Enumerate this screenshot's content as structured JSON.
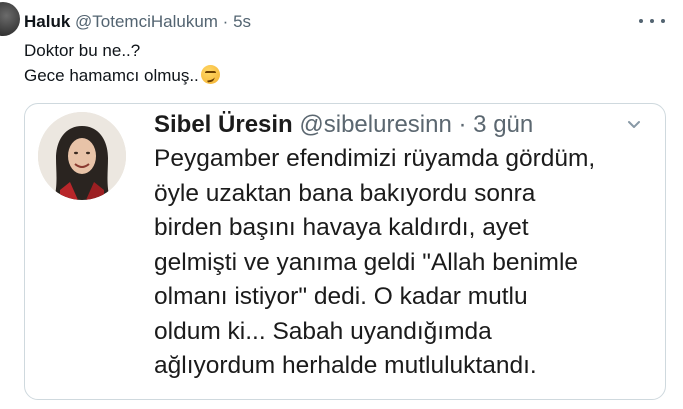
{
  "tweet": {
    "author_name": "Haluk",
    "author_handle": "@TotemciHalukum",
    "separator": "·",
    "time": "5s",
    "lines": [
      "Doktor bu ne..?",
      "Gece hamamcı olmuş.."
    ],
    "emoji": "smirking-face"
  },
  "quote": {
    "author_name": "Sibel Üresin",
    "author_handle": "@sibeluresinn",
    "separator": "·",
    "time": "3 gün",
    "lines": [
      "Peygamber efendimizi rüyamda gördüm,",
      "öyle uzaktan bana bakıyordu sonra",
      "birden başını havaya kaldırdı, ayet",
      "gelmişti ve yanıma geldi \"Allah benimle",
      "olmanı istiyor\" dedi. O kadar mutlu",
      "oldum ki... Sabah uyandığımda",
      "ağlıyordum herhalde mutluluktandı."
    ]
  },
  "colors": {
    "text_primary": "#0f1419",
    "text_secondary": "#536471",
    "card_border": "#cfd9de"
  }
}
